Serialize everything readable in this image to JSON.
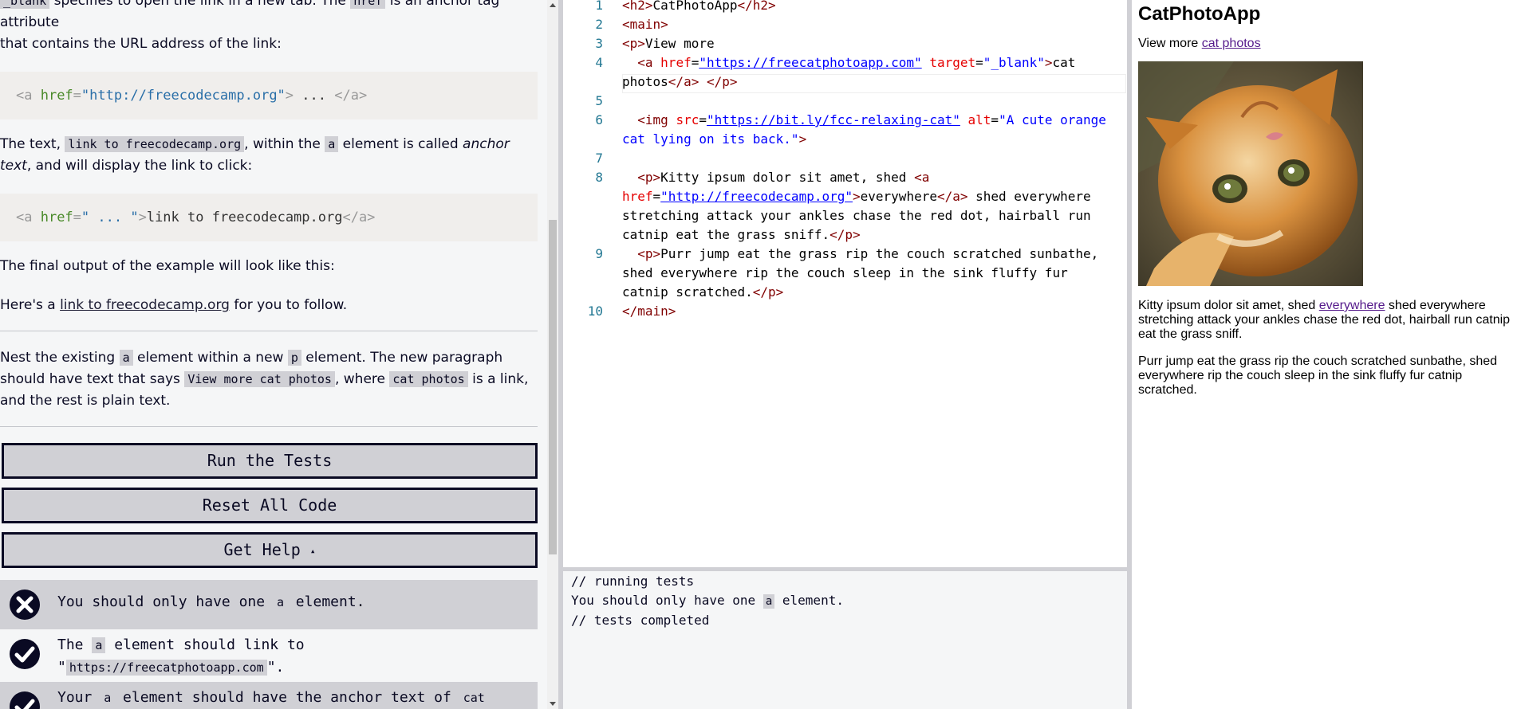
{
  "instructions": {
    "intro_top_code": "_blank",
    "intro_top_mid": " specifies to open the link in a new tab. The ",
    "intro_top_code2": "href",
    "intro_top_end": " is an anchor tag attribute",
    "intro_line2": "that contains the URL address of the link:",
    "code1": {
      "open": "<a ",
      "attr": "href",
      "eq": "=",
      "val": "\"http://freecodecamp.org\"",
      "close": ">",
      "mid": " ... ",
      "end": "</a>"
    },
    "p2_a": "The text, ",
    "p2_code": "link to freecodecamp.org",
    "p2_b": ", within the ",
    "p2_code2": "a",
    "p2_c": " element is called ",
    "p2_em": "anchor text",
    "p2_d": ", and will display the link to click:",
    "code2": {
      "open": "<a ",
      "attr": "href",
      "eq": "=",
      "val": "\" ... \"",
      "close": ">",
      "mid": "link to freecodecamp.org",
      "end": "</a>"
    },
    "p3": "The final output of the example will look like this:",
    "p4_a": "Here's a ",
    "p4_link": "link to freecodecamp.org",
    "p4_b": " for you to follow.",
    "task_a": "Nest the existing ",
    "task_c1": "a",
    "task_b": " element within a new ",
    "task_c2": "p",
    "task_c": " element. The new paragraph should have text that says ",
    "task_c3": "View more cat photos",
    "task_d": ", where ",
    "task_c4": "cat photos",
    "task_e": " is a link, and the rest is plain text."
  },
  "buttons": {
    "run": "Run the Tests",
    "reset": "Reset All Code",
    "help": "Get Help",
    "help_caret": "▴"
  },
  "tests": [
    {
      "status": "fail",
      "a": "You should only have one ",
      "code": "a",
      "b": " element."
    },
    {
      "status": "pass",
      "a": "The ",
      "code": "a",
      "b": " element should link to \"",
      "code2": "https://freecatphotoapp.com",
      "c": "\"."
    },
    {
      "status": "pass",
      "a": "Your ",
      "code": "a",
      "b": " element should have the anchor text of ",
      "code2": "cat photos"
    }
  ],
  "editor": {
    "line_numbers": [
      "1",
      "2",
      "3",
      "4",
      "5",
      "6",
      "7",
      "8",
      "9",
      "10"
    ],
    "l1": {
      "open": "<h2>",
      "text": "CatPhotoApp",
      "close": "</h2>"
    },
    "l2": "<main>",
    "l3": {
      "open": "<p>",
      "text": "View more"
    },
    "l4": {
      "lt": "<a ",
      "attr1": "href",
      "eq": "=",
      "val1": "\"https://freecatphotoapp.com\"",
      "attr2": "target",
      "val2": "\"_blank\"",
      "gt": ">",
      "text": "cat photos",
      "close_a": "</a>",
      "close_p": "</p>"
    },
    "l6": {
      "lt": "<img ",
      "attr1": "src",
      "val1": "\"https://bit.ly/fcc-relaxing-cat\"",
      "attr2": "alt",
      "val2": "\"A cute orange cat lying on its back.\"",
      "gt": ">"
    },
    "l8": {
      "open": "<p>",
      "text1": "Kitty ipsum dolor sit amet, shed ",
      "lt": "<a ",
      "attr": "href",
      "val": "\"http://freecodecamp.org\"",
      "gt": ">",
      "text2": "everywhere",
      "close_a": "</a>",
      "text3": " shed everywhere stretching attack your ankles chase the red dot, hairball run catnip eat the grass sniff.",
      "close": "</p>"
    },
    "l9": {
      "open": "<p>",
      "text": "Purr jump eat the grass rip the couch scratched sunbathe, shed everywhere rip the couch sleep in the sink fluffy fur catnip scratched.",
      "close": "</p>"
    },
    "l10": "</main>"
  },
  "console": {
    "line1": "// running tests",
    "line2_a": "You should only have one ",
    "line2_code": "a",
    "line2_b": " element.",
    "line3": "// tests completed"
  },
  "preview": {
    "title": "CatPhotoApp",
    "p1_text": "View more ",
    "p1_link": "cat photos",
    "p2_a": "Kitty ipsum dolor sit amet, shed ",
    "p2_link": "everywhere",
    "p2_b": " shed everywhere stretching attack your ankles chase the red dot, hairball run catnip eat the grass sniff.",
    "p3": "Purr jump eat the grass rip the couch scratched sunbathe, shed everywhere rip the couch sleep in the sink fluffy fur catnip scratched."
  },
  "colors": {
    "fail": "#0a0a23",
    "pass": "#0a0a23",
    "link_visited": "#551a8b"
  }
}
